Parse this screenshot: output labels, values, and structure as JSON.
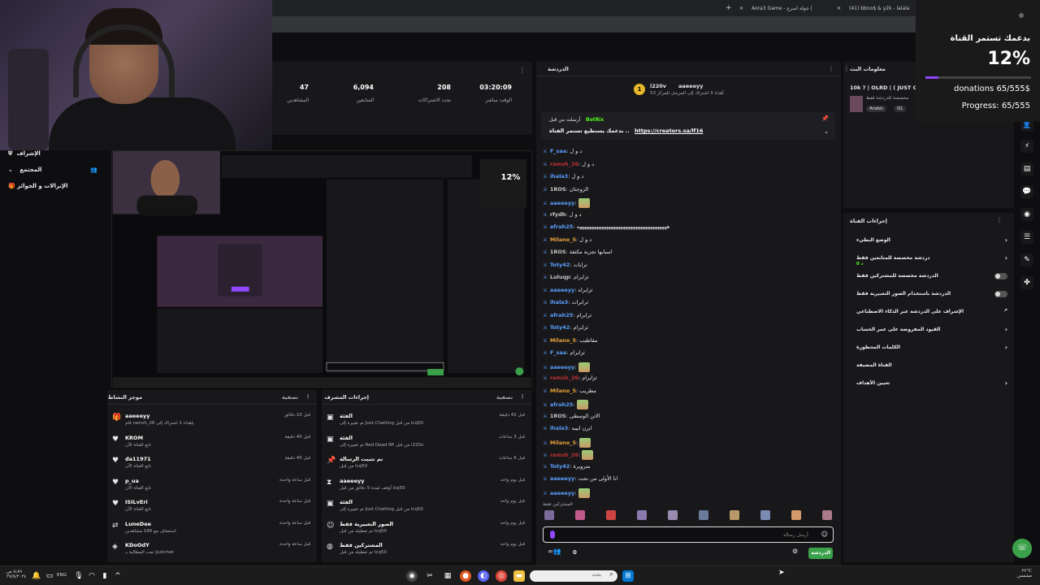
{
  "browser": {
    "tabs": [
      {
        "label": "(41) bbno$ & y2k - lalala"
      },
      {
        "label": "Aora3 Game - جولة اسرع |"
      }
    ],
    "address_hint": "dash"
  },
  "stats": [
    {
      "value": "03:20:09",
      "label": "الوقت مباشر"
    },
    {
      "value": "208",
      "label": "تجدد الاشتراكات"
    },
    {
      "value": "6,094",
      "label": "المتابعين"
    },
    {
      "value": "47",
      "label": "المشاهدين"
    }
  ],
  "leftnav": {
    "items": [
      {
        "label": "الإشراف"
      },
      {
        "label": "المجتمع"
      },
      {
        "label": "الإنزالات و الجوائز"
      }
    ]
  },
  "activity_feed": {
    "title": "موجز النشاط",
    "filter": "تصفية",
    "rows": [
      {
        "title": "aaeeeyy",
        "desc": "قام ramsh_26 بإهداء 1 اشتراك إلى",
        "time": "قبل 10 دقائق"
      },
      {
        "title": "KROM",
        "desc": "تابع القناة الآن",
        "time": "قبل 40 دقيقة"
      },
      {
        "title": "da11971",
        "desc": "تابع القناة الآن",
        "time": "قبل 40 دقيقة"
      },
      {
        "title": "p_ua",
        "desc": "تابع القناة الآن",
        "time": "قبل ساعة واحدة"
      },
      {
        "title": "ISILvEri",
        "desc": "تابع القناة الآن",
        "time": "قبل ساعة واحدة"
      },
      {
        "title": "LuneDee",
        "desc": "استضاف مع 166 مشاهدين",
        "time": "قبل ساعة واحدة"
      },
      {
        "title": "KDoOdY",
        "desc": "تمت المطالبة بـ Justchat",
        "time": "قبل ساعة واحدة"
      }
    ]
  },
  "mod_actions": {
    "title": "إجراءات المشرف",
    "filter": "تصفية",
    "rows": [
      {
        "title": "الفئة",
        "desc": "تم تغييره إلى Just Chatting من قبل lcq50",
        "time": "قبل 42 دقيقة"
      },
      {
        "title": "الفئة",
        "desc": "تم تغييره إلى Red Dead RP من قبل i220v",
        "time": "قبل 3 ساعات"
      },
      {
        "title": "تم تثبيت الرسالة",
        "desc": "من قبل lcq50",
        "time": "قبل 6 ساعات"
      },
      {
        "title": "aaeeeyy",
        "desc": "أوقف لمدة 5 دقائق من قبل lcq50",
        "time": "قبل يوم واحد"
      },
      {
        "title": "الفئة",
        "desc": "تم تغييره إلى Just Chatting من قبل lcq50",
        "time": "قبل يوم واحد"
      },
      {
        "title": "الصور التعبيرية فقط",
        "desc": "تم تعطيله من قبل lcq50",
        "time": "قبل يوم واحد"
      },
      {
        "title": "المشتركين فقط",
        "desc": "تم تعطيله من قبل lcq50",
        "time": "قبل يوم واحد"
      }
    ]
  },
  "chat": {
    "title": "الدردشة",
    "top_user": "i220v",
    "top_user2": "aaeeeyy",
    "top_line": "أهداء 3 اشتراك إلى المرسل للمركز 53",
    "pinned_user": "BotRix",
    "pinned_text": "أرسلت من قبل",
    "pinned_link": "https://creators.sa/lf16",
    "pinned_prefix": "بدعمك يستطيع تستمر القناة ..",
    "messages": [
      {
        "user": "F_saa",
        "text": "د و ل",
        "color": "#5aa0ff"
      },
      {
        "user": "ramsh_26",
        "text": "د و ل",
        "color": "#c03030"
      },
      {
        "user": "ihala3",
        "text": "د و ل",
        "color": "#5aa0ff"
      },
      {
        "user": "1ROS",
        "text": "الزوجتان",
        "color": "#c8c8c8"
      },
      {
        "user": "aaeeeyy",
        "text": "",
        "color": "#5aa0ff"
      },
      {
        "user": "rfydh",
        "text": "د و ل",
        "color": "#c8c8c8"
      },
      {
        "user": "afrah25",
        "text": "هههههههههههههههههههههههههههههههههههههه",
        "color": "#5aa0ff"
      },
      {
        "user": "Milano_5",
        "text": "د و ل",
        "color": "#e8a33a"
      },
      {
        "user": "1ROS",
        "text": "اسبابها تجربة مكثفة",
        "color": "#c8c8c8"
      },
      {
        "user": "Toty42",
        "text": "ثرابات",
        "color": "#5aa0ff"
      },
      {
        "user": "Luluqp",
        "text": "ثزابرام",
        "color": "#c8c8c8"
      },
      {
        "user": "aaeeeyy",
        "text": "ثزابراه",
        "color": "#5aa0ff"
      },
      {
        "user": "ihala3",
        "text": "ثرابرات",
        "color": "#5aa0ff"
      },
      {
        "user": "afrah25",
        "text": "ثزابرام",
        "color": "#5aa0ff"
      },
      {
        "user": "Toty42",
        "text": "ثزابرام",
        "color": "#5aa0ff"
      },
      {
        "user": "Milano_5",
        "text": "مقاطيب",
        "color": "#e8a33a"
      },
      {
        "user": "F_saa",
        "text": "ثزابرام",
        "color": "#5aa0ff"
      },
      {
        "user": "aaeeeyy",
        "text": "",
        "color": "#5aa0ff"
      },
      {
        "user": "ramsh_26",
        "text": "ثزابرام",
        "color": "#c03030"
      },
      {
        "user": "Milano_5",
        "text": "مطريب",
        "color": "#e8a33a"
      },
      {
        "user": "afrah25",
        "text": "",
        "color": "#5aa0ff"
      },
      {
        "user": "1ROS",
        "text": "الاتن الوسطى",
        "color": "#c8c8c8"
      },
      {
        "user": "ihala3",
        "text": "ابرن ابيبه",
        "color": "#5aa0ff"
      },
      {
        "user": "Milano_5",
        "text": "",
        "color": "#e8a33a"
      },
      {
        "user": "ramsh_26",
        "text": "",
        "color": "#c03030"
      },
      {
        "user": "Toty42",
        "text": "مترويرة",
        "color": "#5aa0ff"
      },
      {
        "user": "aaeeeyy",
        "text": "انا الأولى من نحت",
        "color": "#5aa0ff"
      },
      {
        "user": "aaeeeyy",
        "text": "",
        "color": "#5aa0ff"
      }
    ],
    "subs_only_label": "المشتركين فقط",
    "input_placeholder": "أرسل رسالة",
    "send_label": "الدردشة",
    "count": "0"
  },
  "stream_info": {
    "title": "معلومات البث",
    "stream_title": "10k ? | OLRD | ( JUST CH",
    "tags": [
      "Arabic",
      "OL"
    ],
    "desc": "مخصصة للدردشة فقط"
  },
  "channel_actions": {
    "title": "إجراءات القناة",
    "items": [
      {
        "label": "الوضع البطيء",
        "kind": "chevron"
      },
      {
        "label": "دردشة مخصصة للمتابعين فقط",
        "kind": "chevron",
        "sub": "0 د"
      },
      {
        "label": "الدردشة مخصصة للمشتركين فقط",
        "kind": "toggle"
      },
      {
        "label": "الدردشة باستخدام الصور التعبيرية فقط",
        "kind": "toggle"
      },
      {
        "label": "الإشراف على الدردشة عبر الذكاء الاصطناعي",
        "kind": "link"
      },
      {
        "label": "القيود المفروضة على عمر الحساب",
        "kind": "chevron"
      },
      {
        "label": "الكلمات المحظورة",
        "kind": "chevron"
      },
      {
        "label": "القناة المضيفة",
        "kind": "none"
      },
      {
        "label": "تعيين الأهداف",
        "kind": "chevron"
      }
    ]
  },
  "overlay": {
    "heading": "بدعمك تستمر القناة",
    "percent": "12%",
    "percent_value": 12,
    "donations": "donations 65/555$",
    "progress": "Progress: 65/555"
  },
  "taskbar": {
    "lang": "ENG",
    "search": "بحث",
    "time": "٥:٨٩ ص",
    "date": "٢٧/٥/٢٠٢٤",
    "weather": "٢٢°C",
    "weather_desc": "مشمس"
  },
  "colors": {
    "accent": "#53fc18",
    "purple": "#9146ff"
  }
}
